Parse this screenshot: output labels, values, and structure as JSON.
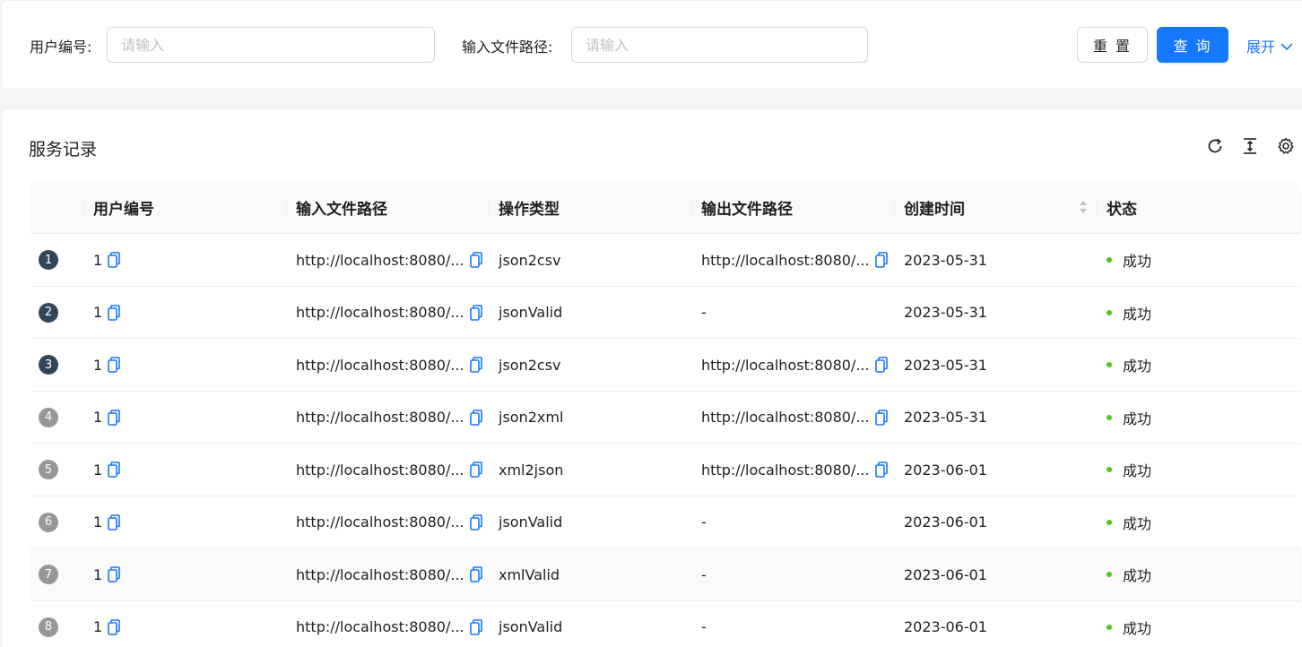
{
  "search": {
    "user_id_label": "用户编号:",
    "user_id_placeholder": "请输入",
    "input_path_label": "输入文件路径:",
    "input_path_placeholder": "请输入",
    "reset_label": "重 置",
    "query_label": "查 询",
    "expand_label": "展开"
  },
  "table_card": {
    "title": "服务记录",
    "columns": [
      "用户编号",
      "输入文件路径",
      "操作类型",
      "输出文件路径",
      "创建时间",
      "状态"
    ],
    "rows": [
      {
        "index": "1",
        "user_id": "1",
        "input_path": "http://localhost:8080/...",
        "op_type": "json2csv",
        "output_path": "http://localhost:8080/...",
        "created": "2023-05-31",
        "status": "成功"
      },
      {
        "index": "2",
        "user_id": "1",
        "input_path": "http://localhost:8080/...",
        "op_type": "jsonValid",
        "output_path": "-",
        "created": "2023-05-31",
        "status": "成功"
      },
      {
        "index": "3",
        "user_id": "1",
        "input_path": "http://localhost:8080/...",
        "op_type": "json2csv",
        "output_path": "http://localhost:8080/...",
        "created": "2023-05-31",
        "status": "成功"
      },
      {
        "index": "4",
        "user_id": "1",
        "input_path": "http://localhost:8080/...",
        "op_type": "json2xml",
        "output_path": "http://localhost:8080/...",
        "created": "2023-05-31",
        "status": "成功"
      },
      {
        "index": "5",
        "user_id": "1",
        "input_path": "http://localhost:8080/...",
        "op_type": "xml2json",
        "output_path": "http://localhost:8080/...",
        "created": "2023-06-01",
        "status": "成功"
      },
      {
        "index": "6",
        "user_id": "1",
        "input_path": "http://localhost:8080/...",
        "op_type": "jsonValid",
        "output_path": "-",
        "created": "2023-06-01",
        "status": "成功"
      },
      {
        "index": "7",
        "user_id": "1",
        "input_path": "http://localhost:8080/...",
        "op_type": "xmlValid",
        "output_path": "-",
        "created": "2023-06-01",
        "status": "成功"
      },
      {
        "index": "8",
        "user_id": "1",
        "input_path": "http://localhost:8080/...",
        "op_type": "jsonValid",
        "output_path": "-",
        "created": "2023-06-01",
        "status": "成功"
      }
    ]
  },
  "colors": {
    "primary": "#1677ff",
    "success": "#52c41a",
    "index_dark": "#314659",
    "index_gray": "#979797"
  }
}
